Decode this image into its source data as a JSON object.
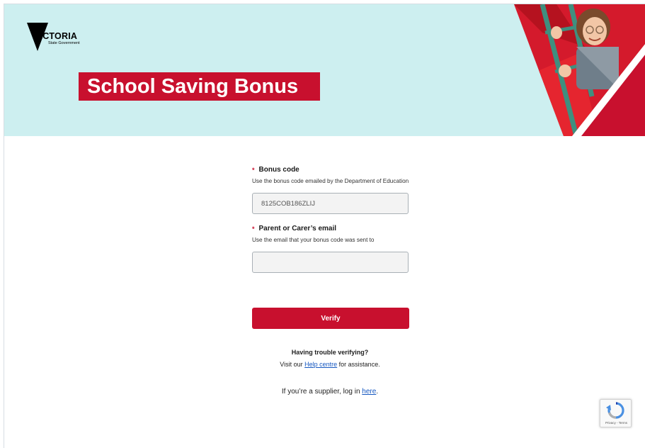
{
  "header": {
    "logo_word": "VICTORIA",
    "logo_sub": "State Government",
    "title": "School Saving Bonus"
  },
  "form": {
    "bonus_code": {
      "label": "Bonus code",
      "required_mark": "*",
      "hint": "Use the bonus code emailed by the Department of Education",
      "value": "8125COB186ZLIJ"
    },
    "email": {
      "label": "Parent or Carer’s email",
      "required_mark": "*",
      "hint": "Use the email that your bonus code was sent to",
      "value": ""
    },
    "verify_label": "Verify"
  },
  "help": {
    "heading": "Having trouble verifying?",
    "prefix": "Visit our ",
    "link_text": "Help centre",
    "suffix": " for assistance."
  },
  "supplier": {
    "prefix": "If you’re a supplier, log in ",
    "link_text": "here",
    "suffix": "."
  },
  "recaptcha": {
    "terms": "Privacy - Terms"
  },
  "colors": {
    "brand_red": "#c8102e",
    "banner_teal": "#cdeff0",
    "link_blue": "#1557c0"
  }
}
